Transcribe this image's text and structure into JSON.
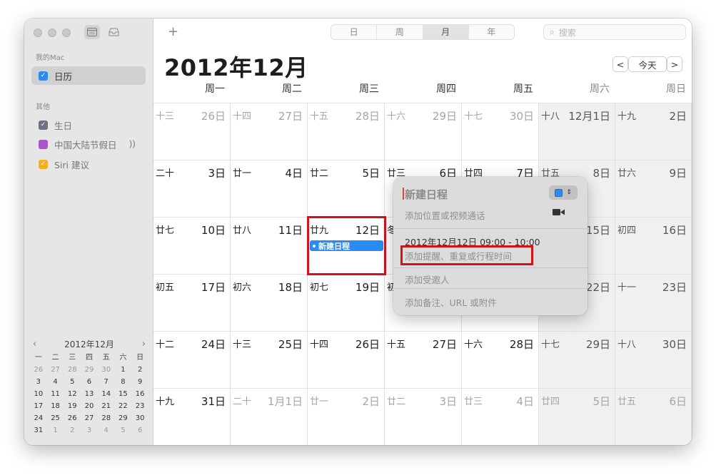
{
  "sidebar": {
    "section_mac": "我的Mac",
    "calendar_item": "日历",
    "section_other": "其他",
    "other_items": [
      {
        "label": "生日",
        "color": "#6b7280"
      },
      {
        "label": "中国大陆节假日",
        "color": "#a855c7"
      },
      {
        "label": "Siri 建议",
        "color": "#f2b124"
      }
    ],
    "calendar_color": "#2a8bf2"
  },
  "mini_calendar": {
    "title": "2012年12月",
    "weekdays": [
      "一",
      "二",
      "三",
      "四",
      "五",
      "六",
      "日"
    ],
    "weeks": [
      [
        "26",
        "27",
        "28",
        "29",
        "30",
        "1",
        "2"
      ],
      [
        "3",
        "4",
        "5",
        "6",
        "7",
        "8",
        "9"
      ],
      [
        "10",
        "11",
        "12",
        "13",
        "14",
        "15",
        "16"
      ],
      [
        "17",
        "18",
        "19",
        "20",
        "21",
        "22",
        "23"
      ],
      [
        "24",
        "25",
        "26",
        "27",
        "28",
        "29",
        "30"
      ],
      [
        "31",
        "1",
        "2",
        "3",
        "4",
        "5",
        "6"
      ]
    ]
  },
  "toolbar": {
    "add": "+",
    "views": [
      "日",
      "周",
      "月",
      "年"
    ],
    "active_view": "月",
    "search_placeholder": "搜索"
  },
  "header": {
    "month_title": "2012年12月",
    "prev": "<",
    "today": "今天",
    "next": ">",
    "weekdays": [
      "周一",
      "周二",
      "周三",
      "周四",
      "周五",
      "周六",
      "周日"
    ]
  },
  "weeks": [
    [
      {
        "lunar": "十三",
        "solar": "26日",
        "other": true
      },
      {
        "lunar": "十四",
        "solar": "27日",
        "other": true
      },
      {
        "lunar": "十五",
        "solar": "28日",
        "other": true
      },
      {
        "lunar": "十六",
        "solar": "29日",
        "other": true
      },
      {
        "lunar": "十七",
        "solar": "30日",
        "other": true
      },
      {
        "lunar": "十八",
        "solar": "12月1日",
        "other": false
      },
      {
        "lunar": "十九",
        "solar": "2日",
        "other": false
      }
    ],
    [
      {
        "lunar": "二十",
        "solar": "3日",
        "other": false
      },
      {
        "lunar": "廿一",
        "solar": "4日",
        "other": false
      },
      {
        "lunar": "廿二",
        "solar": "5日",
        "other": false
      },
      {
        "lunar": "廿三",
        "solar": "6日",
        "other": false
      },
      {
        "lunar": "廿四",
        "solar": "7日",
        "other": false
      },
      {
        "lunar": "廿五",
        "solar": "8日",
        "other": false
      },
      {
        "lunar": "廿六",
        "solar": "9日",
        "other": false
      }
    ],
    [
      {
        "lunar": "廿七",
        "solar": "10日",
        "other": false
      },
      {
        "lunar": "廿八",
        "solar": "11日",
        "other": false
      },
      {
        "lunar": "廿九",
        "solar": "12日",
        "other": false
      },
      {
        "lunar": "冬",
        "solar": "",
        "other": false
      },
      {
        "lunar": "",
        "solar": "",
        "other": false
      },
      {
        "lunar": "",
        "solar": "15日",
        "other": false
      },
      {
        "lunar": "初四",
        "solar": "16日",
        "other": false
      }
    ],
    [
      {
        "lunar": "初五",
        "solar": "17日",
        "other": false
      },
      {
        "lunar": "初六",
        "solar": "18日",
        "other": false
      },
      {
        "lunar": "初七",
        "solar": "19日",
        "other": false
      },
      {
        "lunar": "初",
        "solar": "",
        "other": false
      },
      {
        "lunar": "",
        "solar": "",
        "other": false
      },
      {
        "lunar": "",
        "solar": "22日",
        "other": false
      },
      {
        "lunar": "十一",
        "solar": "23日",
        "other": false
      }
    ],
    [
      {
        "lunar": "十二",
        "solar": "24日",
        "other": false
      },
      {
        "lunar": "十三",
        "solar": "25日",
        "other": false
      },
      {
        "lunar": "十四",
        "solar": "26日",
        "other": false
      },
      {
        "lunar": "十五",
        "solar": "27日",
        "other": false
      },
      {
        "lunar": "十六",
        "solar": "28日",
        "other": false
      },
      {
        "lunar": "十七",
        "solar": "29日",
        "other": false
      },
      {
        "lunar": "十八",
        "solar": "30日",
        "other": false
      }
    ],
    [
      {
        "lunar": "十九",
        "solar": "31日",
        "other": false
      },
      {
        "lunar": "二十",
        "solar": "1月1日",
        "other": true
      },
      {
        "lunar": "廿一",
        "solar": "2日",
        "other": true
      },
      {
        "lunar": "廿二",
        "solar": "3日",
        "other": true
      },
      {
        "lunar": "廿三",
        "solar": "4日",
        "other": true
      },
      {
        "lunar": "廿四",
        "solar": "5日",
        "other": true
      },
      {
        "lunar": "廿五",
        "solar": "6日",
        "other": true
      }
    ]
  ],
  "event": {
    "label": "新建日程",
    "color": "#2a8bf2"
  },
  "popover": {
    "title": "新建日程",
    "location_placeholder": "添加位置或视频通话",
    "datetime": "2012年12月12日  09:00 - 10:00",
    "alert_placeholder": "添加提醒、重复或行程时间",
    "invitees_placeholder": "添加受邀人",
    "notes_placeholder": "添加备注、URL 或附件",
    "calendar_color": "#2a8bf2"
  },
  "highlight_color": "#d5121a"
}
